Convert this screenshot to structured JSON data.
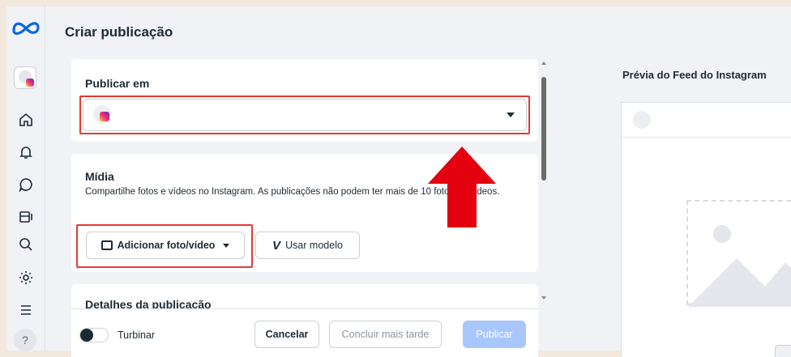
{
  "page": {
    "title": "Criar publicação"
  },
  "sidebar": {
    "items": [
      {
        "icon": "meta-logo-icon"
      },
      {
        "icon": "account-avatar-icon"
      },
      {
        "icon": "home-icon"
      },
      {
        "icon": "notifications-bell-icon"
      },
      {
        "icon": "chat-icon"
      },
      {
        "icon": "content-icon"
      },
      {
        "icon": "search-icon"
      },
      {
        "icon": "settings-gear-icon"
      },
      {
        "icon": "menu-list-icon"
      },
      {
        "icon": "help-icon"
      }
    ],
    "help_label": "?"
  },
  "publish_in": {
    "title": "Publicar em",
    "account_select_value": ""
  },
  "media": {
    "title": "Mídia",
    "description": "Compartilhe fotos e vídeos no Instagram. As publicações não podem ter mais de 10 fotos ou vídeos.",
    "add_button": "Adicionar foto/vídeo",
    "template_button": "Usar modelo"
  },
  "details": {
    "title": "Detalhes da publicação"
  },
  "footer": {
    "boost_label": "Turbinar",
    "boost_enabled": false,
    "cancel": "Cancelar",
    "finish_later": "Concluir mais tarde",
    "publish": "Publicar"
  },
  "preview": {
    "title": "Prévia do Feed do Instagram"
  },
  "colors": {
    "accent_blue": "#a8c7ff",
    "highlight_red": "#e53935",
    "background": "#f0f2f5"
  }
}
